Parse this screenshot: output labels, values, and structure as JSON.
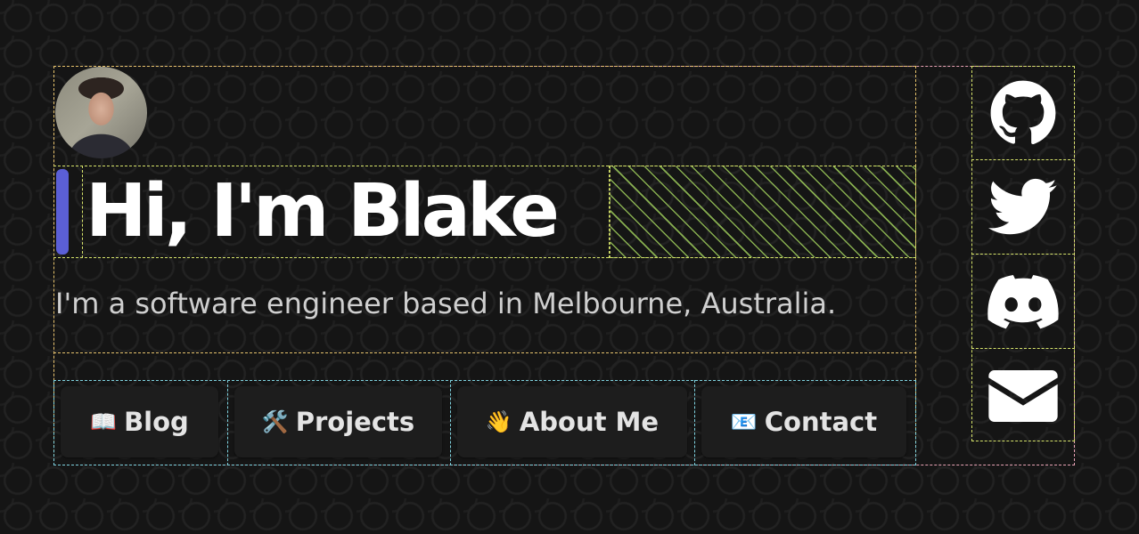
{
  "hero": {
    "title": "Hi, I'm Blake",
    "subtitle": "I'm a software engineer based in Melbourne, Australia."
  },
  "nav": [
    {
      "emoji": "📖",
      "label": "Blog"
    },
    {
      "emoji": "🛠️",
      "label": "Projects"
    },
    {
      "emoji": "👋",
      "label": "About Me"
    },
    {
      "emoji": "📧",
      "label": "Contact"
    }
  ],
  "social": [
    {
      "icon": "github-icon"
    },
    {
      "icon": "twitter-icon"
    },
    {
      "icon": "discord-icon"
    },
    {
      "icon": "mail-icon"
    }
  ],
  "colors": {
    "accent": "#5b5fd6",
    "background": "#151515"
  }
}
